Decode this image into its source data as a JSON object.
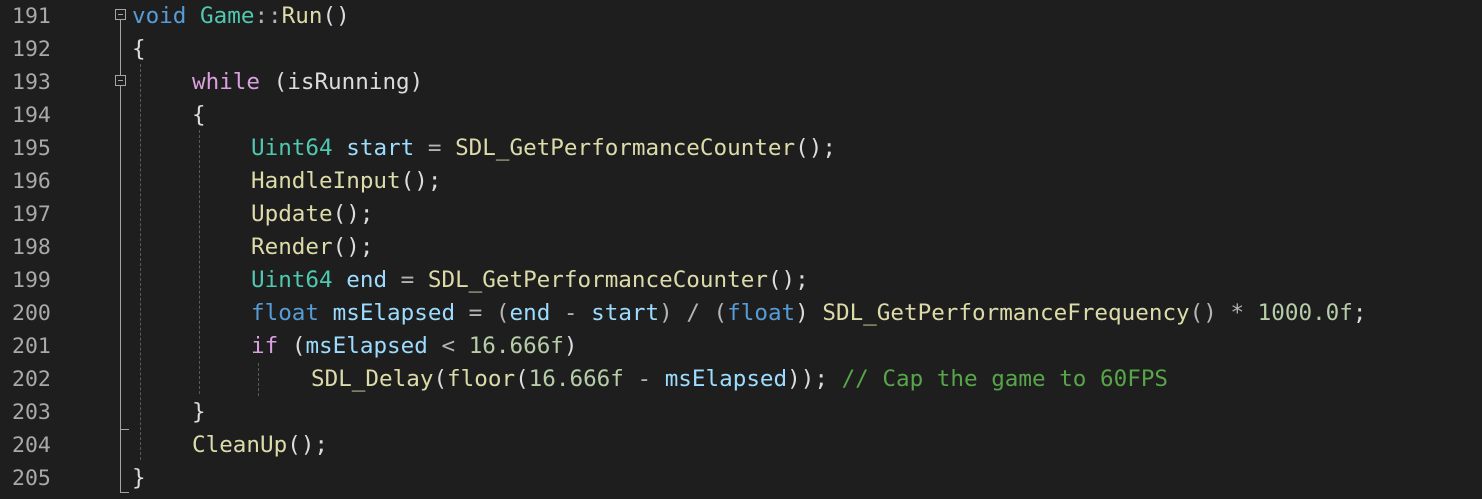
{
  "editor": {
    "lines": [
      {
        "number": "191",
        "tokens": [
          {
            "t": "void",
            "c": "kw"
          },
          {
            "t": " ",
            "c": "punc"
          },
          {
            "t": "Game",
            "c": "type"
          },
          {
            "t": "::",
            "c": "op"
          },
          {
            "t": "Run",
            "c": "fn"
          },
          {
            "t": "()",
            "c": "punc"
          }
        ]
      },
      {
        "number": "192",
        "tokens": [
          {
            "t": "{",
            "c": "punc"
          }
        ]
      },
      {
        "number": "193",
        "tokens": [
          {
            "t": "while",
            "c": "ctl"
          },
          {
            "t": " (",
            "c": "punc"
          },
          {
            "t": "isRunning",
            "c": "punc"
          },
          {
            "t": ")",
            "c": "punc"
          }
        ]
      },
      {
        "number": "194",
        "tokens": [
          {
            "t": "{",
            "c": "punc"
          }
        ]
      },
      {
        "number": "195",
        "tokens": [
          {
            "t": "Uint64",
            "c": "type"
          },
          {
            "t": " ",
            "c": "punc"
          },
          {
            "t": "start",
            "c": "var"
          },
          {
            "t": " = ",
            "c": "op"
          },
          {
            "t": "SDL_GetPerformanceCounter",
            "c": "fn"
          },
          {
            "t": "();",
            "c": "punc"
          }
        ]
      },
      {
        "number": "196",
        "tokens": [
          {
            "t": "HandleInput",
            "c": "fn"
          },
          {
            "t": "();",
            "c": "punc"
          }
        ]
      },
      {
        "number": "197",
        "tokens": [
          {
            "t": "Update",
            "c": "fn"
          },
          {
            "t": "();",
            "c": "punc"
          }
        ]
      },
      {
        "number": "198",
        "tokens": [
          {
            "t": "Render",
            "c": "fn"
          },
          {
            "t": "();",
            "c": "punc"
          }
        ]
      },
      {
        "number": "199",
        "tokens": [
          {
            "t": "Uint64",
            "c": "type"
          },
          {
            "t": " ",
            "c": "punc"
          },
          {
            "t": "end",
            "c": "var"
          },
          {
            "t": " = ",
            "c": "op"
          },
          {
            "t": "SDL_GetPerformanceCounter",
            "c": "fn"
          },
          {
            "t": "();",
            "c": "punc"
          }
        ]
      },
      {
        "number": "200",
        "tokens": [
          {
            "t": "float",
            "c": "kw"
          },
          {
            "t": " ",
            "c": "punc"
          },
          {
            "t": "msElapsed",
            "c": "var"
          },
          {
            "t": " = (",
            "c": "op"
          },
          {
            "t": "end",
            "c": "var"
          },
          {
            "t": " - ",
            "c": "op"
          },
          {
            "t": "start",
            "c": "var"
          },
          {
            "t": ") / (",
            "c": "op"
          },
          {
            "t": "float",
            "c": "kw"
          },
          {
            "t": ") ",
            "c": "punc"
          },
          {
            "t": "SDL_GetPerformanceFrequency",
            "c": "fn"
          },
          {
            "t": "() * ",
            "c": "op"
          },
          {
            "t": "1000.0f",
            "c": "num"
          },
          {
            "t": ";",
            "c": "punc"
          }
        ]
      },
      {
        "number": "201",
        "tokens": [
          {
            "t": "if",
            "c": "ctl"
          },
          {
            "t": " (",
            "c": "punc"
          },
          {
            "t": "msElapsed",
            "c": "var"
          },
          {
            "t": " < ",
            "c": "op"
          },
          {
            "t": "16.666f",
            "c": "num"
          },
          {
            "t": ")",
            "c": "punc"
          }
        ]
      },
      {
        "number": "202",
        "tokens": [
          {
            "t": "SDL_Delay",
            "c": "fn"
          },
          {
            "t": "(",
            "c": "punc"
          },
          {
            "t": "floor",
            "c": "fn"
          },
          {
            "t": "(",
            "c": "punc"
          },
          {
            "t": "16.666f",
            "c": "num"
          },
          {
            "t": " - ",
            "c": "op"
          },
          {
            "t": "msElapsed",
            "c": "var"
          },
          {
            "t": ")); ",
            "c": "punc"
          },
          {
            "t": "// Cap the game to 60FPS",
            "c": "cmt"
          }
        ]
      },
      {
        "number": "203",
        "tokens": [
          {
            "t": "}",
            "c": "punc"
          }
        ]
      },
      {
        "number": "204",
        "tokens": [
          {
            "t": "CleanUp",
            "c": "fn"
          },
          {
            "t": "();",
            "c": "punc"
          }
        ]
      },
      {
        "number": "205",
        "tokens": [
          {
            "t": "}",
            "c": "punc"
          }
        ]
      }
    ],
    "colors": {
      "background": "#1e1e1e",
      "line_number": "#a9a9a9",
      "keyword": "#569cd6",
      "control": "#d8a0df",
      "type": "#4ec9b0",
      "function": "#dcdcaa",
      "variable": "#9cdcfe",
      "number": "#b5cea8",
      "comment": "#57a64a"
    },
    "fold_icons": [
      "collapse-icon",
      "collapse-icon"
    ]
  }
}
